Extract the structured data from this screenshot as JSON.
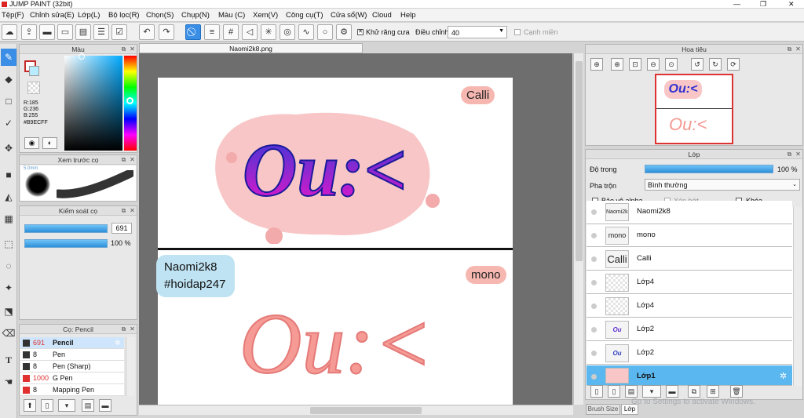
{
  "app": {
    "title": "JUMP PAINT (32bit)"
  },
  "menu": [
    "Tệp(F)",
    "Chỉnh sửa(E)",
    "Lớp(L)",
    "Bộ lọc(R)",
    "Chọn(S)",
    "Chụp(N)",
    "Màu (C)",
    "Xem(V)",
    "Công cụ(T)",
    "Cửa sổ(W)",
    "Cloud",
    "Help"
  ],
  "toolbar": {
    "antialias_label": "Khử răng cưa",
    "adjust_label": "Điều chỉnh",
    "adjust_value": "40",
    "edge_label": "Cạnh miền"
  },
  "color_panel": {
    "title": "Màu",
    "r": "R:185",
    "g": "G:236",
    "b": "B:255",
    "hex": "#B9ECFF",
    "primary_color": "#ffffff",
    "secondary_color": "#b9ecff"
  },
  "brush_preview": {
    "title": "Xem trước cọ",
    "size_label": "5.0mm"
  },
  "brush_control": {
    "title": "Kiểm soát cọ",
    "size_value": "691",
    "opacity_value": "100 %"
  },
  "brush_list": {
    "title": "Cọ: Pencil",
    "items": [
      {
        "size": "691",
        "name": "Pencil",
        "color": "#333333"
      },
      {
        "size": "8",
        "name": "Pen",
        "color": "#333333"
      },
      {
        "size": "8",
        "name": "Pen (Sharp)",
        "color": "#333333"
      },
      {
        "size": "1000",
        "name": "G Pen",
        "color": "#e03030"
      },
      {
        "size": "8",
        "name": "Mapping Pen",
        "color": "#e03030"
      }
    ]
  },
  "document": {
    "tab": "Naomi2k8.png",
    "label_calli": "Calli",
    "label_mono": "mono",
    "watermark_line1": "Naomi2k8",
    "watermark_line2": "#hoidap247",
    "art_text": "Ou:<"
  },
  "navigator": {
    "title": "Hoa tiêu"
  },
  "layers": {
    "title": "Lớp",
    "opacity_label": "Độ trong",
    "opacity_value": "100 %",
    "blend_label": "Pha trộn",
    "blend_value": "Bình thường",
    "protect_alpha": "Bảo vệ alpha",
    "clip": "Xén bớt",
    "lock": "Khóa",
    "items": [
      {
        "name": "Naomi2k8",
        "thumb": "Naomi2k8"
      },
      {
        "name": "mono",
        "thumb": "mono"
      },
      {
        "name": "Calli",
        "thumb": "Calli"
      },
      {
        "name": "Lớp4",
        "thumb": ""
      },
      {
        "name": "Lớp4",
        "thumb": ""
      },
      {
        "name": "Lớp2",
        "thumb": "Ou"
      },
      {
        "name": "Lớp2",
        "thumb": "Ou"
      },
      {
        "name": "Lớp1",
        "thumb": ""
      }
    ]
  },
  "bottom_tabs": {
    "brush_size": "Brush Size",
    "layer": "Lớp"
  },
  "activation": "Go to Settings to activate Windows."
}
